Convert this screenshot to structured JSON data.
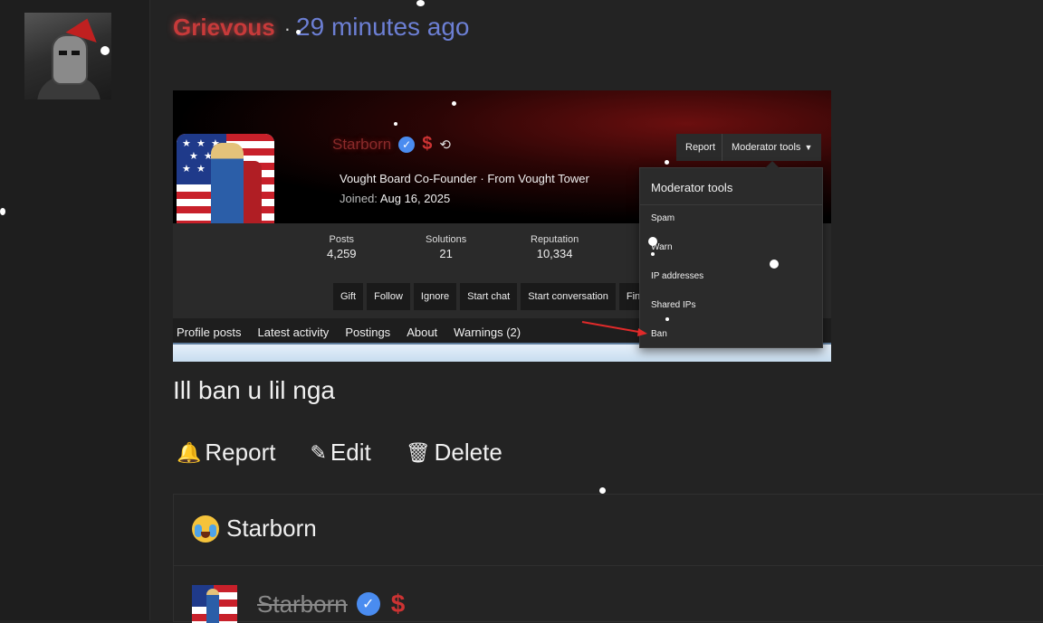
{
  "post": {
    "author": "Grievous",
    "separator": "·",
    "time": "29 minutes ago",
    "text": "Ill ban u lil nga",
    "actions": {
      "report": "Report",
      "edit": "Edit",
      "delete": "Delete"
    }
  },
  "embedded_profile": {
    "name": "Starborn",
    "title_line": "Vought Board Co-Founder · From Vought Tower",
    "joined_label": "Joined:",
    "joined_date": "Aug 16, 2025",
    "report_button": "Report",
    "moderator_tools_button": "Moderator tools",
    "stats": [
      {
        "label": "Posts",
        "value": "4,259"
      },
      {
        "label": "Solutions",
        "value": "21"
      },
      {
        "label": "Reputation",
        "value": "10,334"
      }
    ],
    "action_buttons": [
      "Gift",
      "Follow",
      "Ignore",
      "Start chat",
      "Start conversation",
      "Find"
    ],
    "tabs": [
      "Profile posts",
      "Latest activity",
      "Postings",
      "About",
      "Warnings (2)"
    ],
    "dropdown": {
      "title": "Moderator tools",
      "items": [
        "Spam",
        "Warn",
        "IP addresses",
        "Shared IPs",
        "Ban"
      ]
    }
  },
  "reactions": {
    "reaction_name": "Starborn",
    "user": "Starborn"
  },
  "icons": {
    "verified": "verified-check-icon",
    "dollar": "dollar-icon",
    "history": "history-icon",
    "bell": "bell-icon",
    "pencil": "pencil-icon",
    "trash": "trash-icon",
    "crying_emoji": "crying-laughing-emoji-icon"
  },
  "colors": {
    "background": "#232323",
    "author_red": "#c73a3a",
    "time_blue": "#6c7fd4",
    "verified_blue": "#4a8cf0",
    "arrow_red": "#e02a2a"
  }
}
